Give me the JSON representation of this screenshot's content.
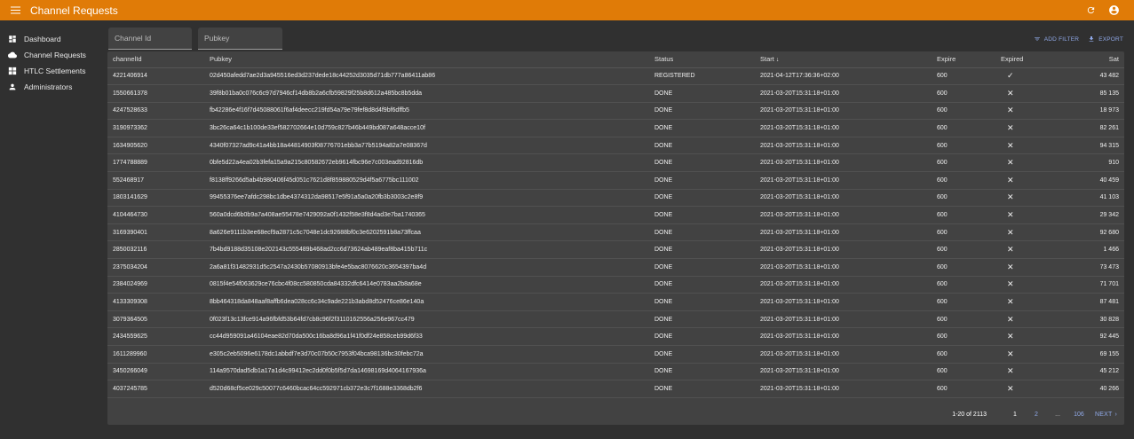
{
  "app": {
    "title": "Channel Requests"
  },
  "sidebar": {
    "items": [
      {
        "label": "Dashboard",
        "icon": "dashboard-icon"
      },
      {
        "label": "Channel Requests",
        "icon": "cloud-icon"
      },
      {
        "label": "HTLC Settlements",
        "icon": "grid-icon"
      },
      {
        "label": "Administrators",
        "icon": "person-icon"
      }
    ]
  },
  "filters": {
    "channel_id_placeholder": "Channel Id",
    "pubkey_placeholder": "Pubkey"
  },
  "actions": {
    "add_filter": "ADD FILTER",
    "export": "EXPORT"
  },
  "table": {
    "columns": {
      "channelId": "channelId",
      "pubkey": "Pubkey",
      "status": "Status",
      "start": "Start",
      "expire": "Expire",
      "expired": "Expired",
      "sat": "Sat"
    },
    "rows": [
      {
        "channelId": "4221406914",
        "pubkey": "02d450afedd7ae2d3a945516ed3d237dede18c44252d3035d71db777a86411ab86",
        "status": "REGISTERED",
        "start": "2021-04-12T17:36:36+02:00",
        "expire": "600",
        "expired": "✓",
        "sat": "43 482"
      },
      {
        "channelId": "1550661378",
        "pubkey": "39f8b01ba0c076c6c97d7946cf14db8b2a6cfb59829f25b8d612a485bc8b5dda",
        "status": "DONE",
        "start": "2021-03-20T15:31:18+01:00",
        "expire": "600",
        "expired": "✕",
        "sat": "85 135"
      },
      {
        "channelId": "4247528633",
        "pubkey": "fb42286e4f16f7d45088061f6af4deecc219fd54a79e79fef8d8d4f9bf6dffb5",
        "status": "DONE",
        "start": "2021-03-20T15:31:18+01:00",
        "expire": "600",
        "expired": "✕",
        "sat": "18 973"
      },
      {
        "channelId": "3190973362",
        "pubkey": "3bc26ca64c1b100de33ef582702664e10d759c827b46b449bd087a648acce10f",
        "status": "DONE",
        "start": "2021-03-20T15:31:18+01:00",
        "expire": "600",
        "expired": "✕",
        "sat": "82 261"
      },
      {
        "channelId": "1634905620",
        "pubkey": "4340f07327ad9c41a4bb18a44814903f08776701ebb3a77b5194a82a7e08367d",
        "status": "DONE",
        "start": "2021-03-20T15:31:18+01:00",
        "expire": "600",
        "expired": "✕",
        "sat": "94 315"
      },
      {
        "channelId": "1774788889",
        "pubkey": "0bfe5d22a4ea02b3fefa15a9a215c80582672eb9614fbc96e7c003ead92816db",
        "status": "DONE",
        "start": "2021-03-20T15:31:18+01:00",
        "expire": "600",
        "expired": "✕",
        "sat": "910"
      },
      {
        "channelId": "552468917",
        "pubkey": "f8138ff9266d5ab4b980406f45d051c7621d8f859880529d4f5a6775bc111002",
        "status": "DONE",
        "start": "2021-03-20T15:31:18+01:00",
        "expire": "600",
        "expired": "✕",
        "sat": "40 459"
      },
      {
        "channelId": "1803141629",
        "pubkey": "99455376ee7afdc298bc1dbe4374312da98517e5f91a5a0a20fb3b3003c2e8f9",
        "status": "DONE",
        "start": "2021-03-20T15:31:18+01:00",
        "expire": "600",
        "expired": "✕",
        "sat": "41 103"
      },
      {
        "channelId": "4104464730",
        "pubkey": "560a0dcd6b0b9a7a408ae55478e7429092a0f1432f58e3f8d4ad3e7ba1740365",
        "status": "DONE",
        "start": "2021-03-20T15:31:18+01:00",
        "expire": "600",
        "expired": "✕",
        "sat": "29 342"
      },
      {
        "channelId": "3169390401",
        "pubkey": "8a626e9111b3ee68ecf9a2871c5c7048e1dc92688bf0c3e6202591b8a73ffcaa",
        "status": "DONE",
        "start": "2021-03-20T15:31:18+01:00",
        "expire": "600",
        "expired": "✕",
        "sat": "92 680"
      },
      {
        "channelId": "2850032116",
        "pubkey": "7b4bd9188d35108e202143c555489b468ad2cc6d73624ab489eaf8ba415b711c",
        "status": "DONE",
        "start": "2021-03-20T15:31:18+01:00",
        "expire": "600",
        "expired": "✕",
        "sat": "1 466"
      },
      {
        "channelId": "2375034204",
        "pubkey": "2a6a81f31482931d5c2547a2430b57080913bfe4e5bac8076620c3654397ba4d",
        "status": "DONE",
        "start": "2021-03-20T15:31:18+01:00",
        "expire": "600",
        "expired": "✕",
        "sat": "73 473"
      },
      {
        "channelId": "2384024969",
        "pubkey": "0815f4e54f063629ce76cbc4f08cc580850cda84332dfc6414e0783aa2b8a68e",
        "status": "DONE",
        "start": "2021-03-20T15:31:18+01:00",
        "expire": "600",
        "expired": "✕",
        "sat": "71 701"
      },
      {
        "channelId": "4133309308",
        "pubkey": "8bb464318da848aaf8affb6dea028cc6c34c9ade221b3abd8d52476ce86e140a",
        "status": "DONE",
        "start": "2021-03-20T15:31:18+01:00",
        "expire": "600",
        "expired": "✕",
        "sat": "87 481"
      },
      {
        "channelId": "3079364505",
        "pubkey": "0f023f13c13fce914a96fbfd53b64fd7cb8c96f2f3110162556a256e967cc479",
        "status": "DONE",
        "start": "2021-03-20T15:31:18+01:00",
        "expire": "600",
        "expired": "✕",
        "sat": "30 828"
      },
      {
        "channelId": "2434559625",
        "pubkey": "cc44d959091a46104eae82d70da500c16ba8d96a1f41f0df24e858ceb99d6f33",
        "status": "DONE",
        "start": "2021-03-20T15:31:18+01:00",
        "expire": "600",
        "expired": "✕",
        "sat": "92 445"
      },
      {
        "channelId": "1611289960",
        "pubkey": "e305c2eb5096e6178dc1abbdf7e3d70c07b50c7953f04bca98136bc30febc72a",
        "status": "DONE",
        "start": "2021-03-20T15:31:18+01:00",
        "expire": "600",
        "expired": "✕",
        "sat": "69 155"
      },
      {
        "channelId": "3450266049",
        "pubkey": "114a9570dad5db1a17a1d4c99412ec2dd0f0b5f5d7da14698169d4064167936a",
        "status": "DONE",
        "start": "2021-03-20T15:31:18+01:00",
        "expire": "600",
        "expired": "✕",
        "sat": "45 212"
      },
      {
        "channelId": "4037245785",
        "pubkey": "d520d68cf5ce029c50077c6460bcac64cc592971cb372e3c7f1688e3368db2f6",
        "status": "DONE",
        "start": "2021-03-20T15:31:18+01:00",
        "expire": "600",
        "expired": "✕",
        "sat": "40 266"
      }
    ]
  },
  "pagination": {
    "range": "1-20 of 2113",
    "pages": [
      "1",
      "2"
    ],
    "dots": "...",
    "last": "106",
    "next": "NEXT"
  }
}
